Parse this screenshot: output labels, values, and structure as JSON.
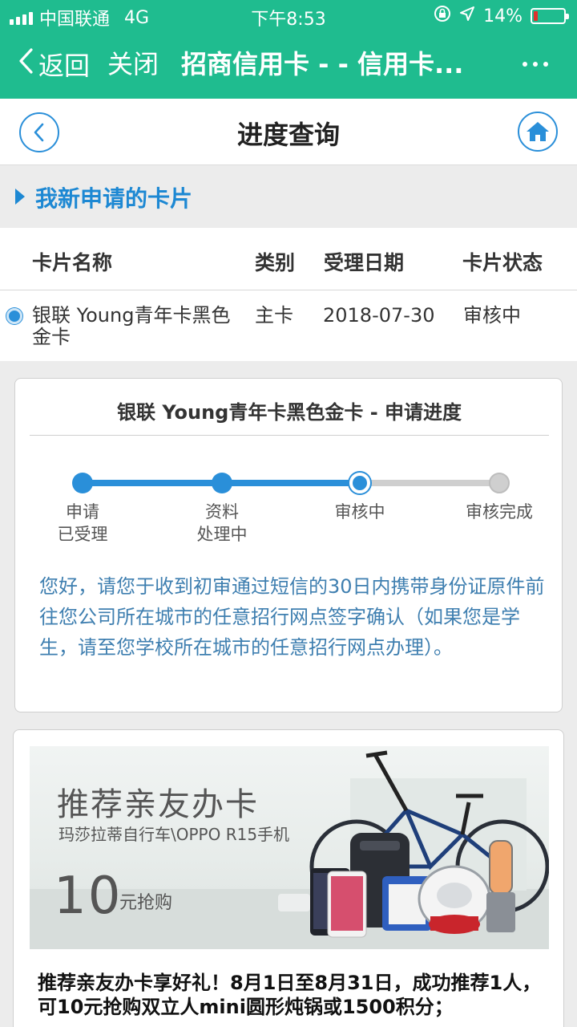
{
  "status_bar": {
    "carrier": "中国联通",
    "network": "4G",
    "time": "下午8:53",
    "battery_percent": "14%",
    "battery_level": 0.14,
    "icons": [
      "signal-icon",
      "lock-rotation-icon",
      "location-icon",
      "battery-icon"
    ]
  },
  "nav": {
    "back_label": "返回",
    "close_label": "关闭",
    "title": "招商信用卡 - - 信用卡...",
    "color": "#1fbc8f"
  },
  "page_header": {
    "title": "进度查询",
    "icons": [
      "back-circle-icon",
      "home-icon"
    ],
    "accent": "#2a8fd9"
  },
  "section": {
    "title": "我新申请的卡片"
  },
  "table": {
    "headers": [
      "卡片名称",
      "类别",
      "受理日期",
      "卡片状态"
    ],
    "rows": [
      {
        "name": "银联 Young青年卡黑色金卡",
        "type": "主卡",
        "date": "2018-07-30",
        "status": "审核中",
        "selected": true
      }
    ]
  },
  "progress": {
    "title": "银联 Young青年卡黑色金卡 - 申请进度",
    "steps": [
      {
        "line1": "申请",
        "line2": "已受理",
        "done": true
      },
      {
        "line1": "资料",
        "line2": "处理中",
        "done": true
      },
      {
        "line1": "审核中",
        "line2": "",
        "done": true,
        "current": true
      },
      {
        "line1": "审核完成",
        "line2": "",
        "done": false
      }
    ],
    "notice": "您好，请您于收到初审通过短信的30日内携带身份证原件前往您公司所在城市的任意招行网点签字确认（如果您是学生，请至您学校所在城市的任意招行网点办理）。",
    "active_color": "#2a8fd9",
    "inactive_color": "#cfcfcf"
  },
  "promo": {
    "banner_title": "推荐亲友办卡",
    "banner_subtitle": "玛莎拉蒂自行车\\OPPO R15手机",
    "banner_price": "10",
    "banner_price_suffix": "元抢购",
    "text": "推荐亲友办卡享好礼！8月1日至8月31日，成功推荐1人，可10元抢购双立人mini圆形炖锅或1500积分；"
  }
}
